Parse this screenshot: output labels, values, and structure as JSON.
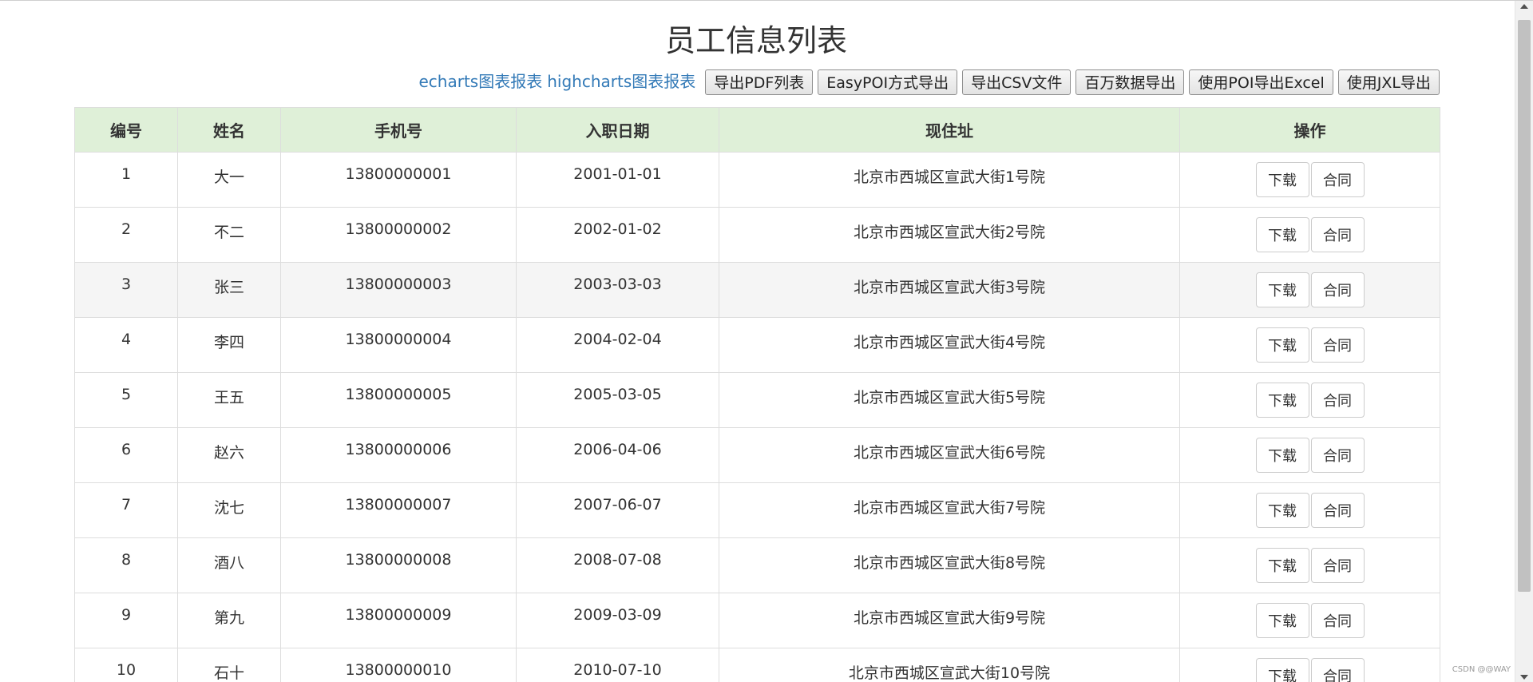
{
  "page": {
    "title": "员工信息列表"
  },
  "toolbar": {
    "links": [
      {
        "label": "echarts图表报表"
      },
      {
        "label": "highcharts图表报表"
      }
    ],
    "buttons": [
      {
        "label": "导出PDF列表"
      },
      {
        "label": "EasyPOI方式导出"
      },
      {
        "label": "导出CSV文件"
      },
      {
        "label": "百万数据导出"
      },
      {
        "label": "使用POI导出Excel"
      },
      {
        "label": "使用JXL导出"
      }
    ]
  },
  "table": {
    "columns": [
      "编号",
      "姓名",
      "手机号",
      "入职日期",
      "现住址",
      "操作"
    ],
    "row_actions": {
      "download": "下载",
      "contract": "合同"
    },
    "rows": [
      {
        "id": "1",
        "name": "大一",
        "phone": "13800000001",
        "hire_date": "2001-01-01",
        "address": "北京市西城区宣武大街1号院"
      },
      {
        "id": "2",
        "name": "不二",
        "phone": "13800000002",
        "hire_date": "2002-01-02",
        "address": "北京市西城区宣武大街2号院"
      },
      {
        "id": "3",
        "name": "张三",
        "phone": "13800000003",
        "hire_date": "2003-03-03",
        "address": "北京市西城区宣武大街3号院"
      },
      {
        "id": "4",
        "name": "李四",
        "phone": "13800000004",
        "hire_date": "2004-02-04",
        "address": "北京市西城区宣武大街4号院"
      },
      {
        "id": "5",
        "name": "王五",
        "phone": "13800000005",
        "hire_date": "2005-03-05",
        "address": "北京市西城区宣武大街5号院"
      },
      {
        "id": "6",
        "name": "赵六",
        "phone": "13800000006",
        "hire_date": "2006-04-06",
        "address": "北京市西城区宣武大街6号院"
      },
      {
        "id": "7",
        "name": "沈七",
        "phone": "13800000007",
        "hire_date": "2007-06-07",
        "address": "北京市西城区宣武大街7号院"
      },
      {
        "id": "8",
        "name": "酒八",
        "phone": "13800000008",
        "hire_date": "2008-07-08",
        "address": "北京市西城区宣武大街8号院"
      },
      {
        "id": "9",
        "name": "第九",
        "phone": "13800000009",
        "hire_date": "2009-03-09",
        "address": "北京市西城区宣武大街9号院"
      },
      {
        "id": "10",
        "name": "石十",
        "phone": "13800000010",
        "hire_date": "2010-07-10",
        "address": "北京市西城区宣武大街10号院"
      }
    ]
  },
  "watermark": "CSDN @@WAY"
}
